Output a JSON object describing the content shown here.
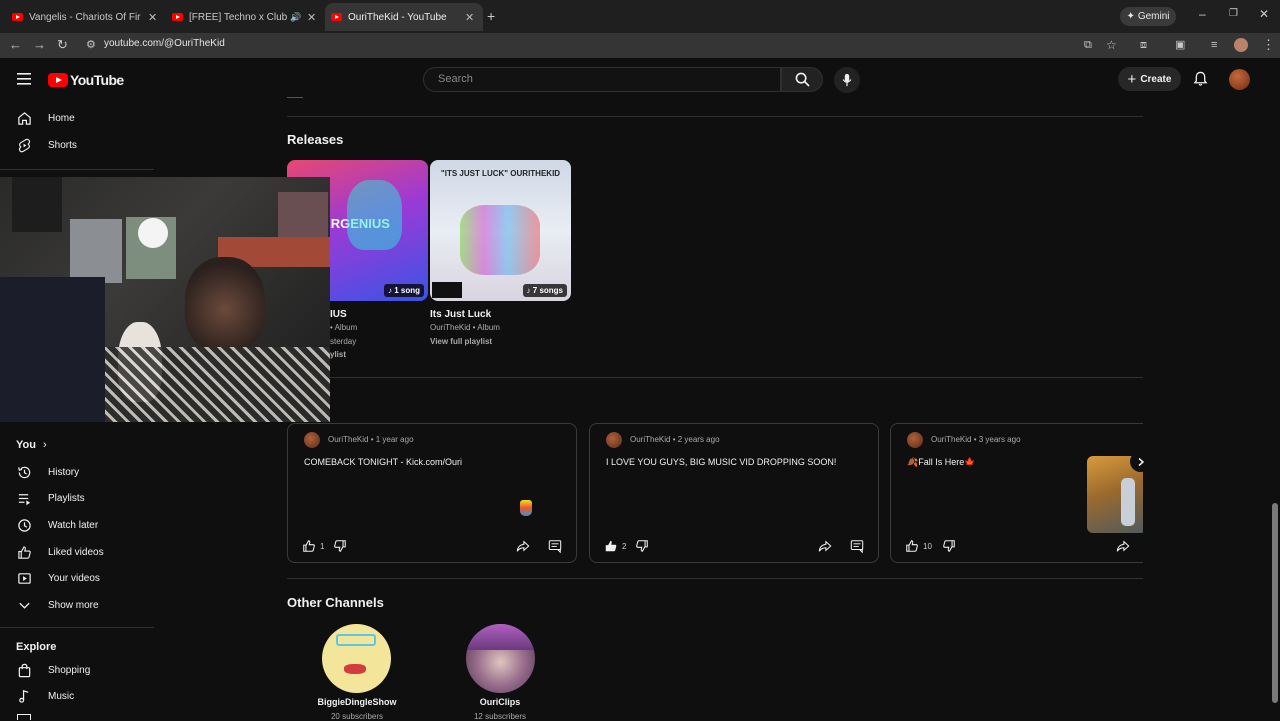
{
  "browser": {
    "tabs": [
      {
        "title": "Vangelis - Chariots Of Fire - You"
      },
      {
        "title": "[FREE] Techno x Club x EDM"
      },
      {
        "title": "OuriTheKid - YouTube"
      }
    ],
    "url": "youtube.com/@OuriTheKid",
    "gemini_label": "Gemini"
  },
  "header": {
    "logo": "YouTube",
    "search_placeholder": "Search",
    "create_label": "Create"
  },
  "sidebar": {
    "top": [
      {
        "label": "Home",
        "icon": "home-icon"
      },
      {
        "label": "Shorts",
        "icon": "shorts-icon"
      }
    ],
    "you_heading": "You",
    "you_items": [
      {
        "label": "History",
        "icon": "history-icon"
      },
      {
        "label": "Playlists",
        "icon": "playlists-icon"
      },
      {
        "label": "Watch later",
        "icon": "clock-icon"
      },
      {
        "label": "Liked videos",
        "icon": "thumb-up-icon"
      },
      {
        "label": "Your videos",
        "icon": "video-icon"
      },
      {
        "label": "Show more",
        "icon": "chevron-down-icon"
      }
    ],
    "explore_heading": "Explore",
    "explore_items": [
      {
        "label": "Shopping",
        "icon": "bag-icon"
      },
      {
        "label": "Music",
        "icon": "music-icon"
      }
    ]
  },
  "releases": {
    "heading": "Releases",
    "items": [
      {
        "art_text": "ERGENIUS",
        "badge": "1 song",
        "title": "IUS",
        "meta": "• Album",
        "date": "sterday",
        "link": "ylist"
      },
      {
        "art_text": "\"ITS JUST LUCK\" OURITHEKID",
        "badge": "7 songs",
        "title": "Its Just Luck",
        "meta": "OuriTheKid • Album",
        "link": "View full playlist"
      }
    ]
  },
  "posts": [
    {
      "author": "OuriTheKid",
      "age": "1 year ago",
      "text": "COMEBACK TONIGHT - Kick.com/Ouri",
      "likes": "1"
    },
    {
      "author": "OuriTheKid",
      "age": "2 years ago",
      "text": "I LOVE YOU GUYS, BIG MUSIC VID DROPPING SOON!",
      "likes": "2"
    },
    {
      "author": "OuriTheKid",
      "age": "3 years ago",
      "text": "🍂Fall Is Here🍁",
      "likes": "10"
    }
  ],
  "other_channels": {
    "heading": "Other Channels",
    "items": [
      {
        "name": "BiggieDingleShow",
        "subs": "20 subscribers"
      },
      {
        "name": "OuriClips",
        "subs": "12 subscribers"
      }
    ]
  },
  "colors": {
    "brand_red": "#ff0000",
    "bg": "#0f0f0f"
  }
}
